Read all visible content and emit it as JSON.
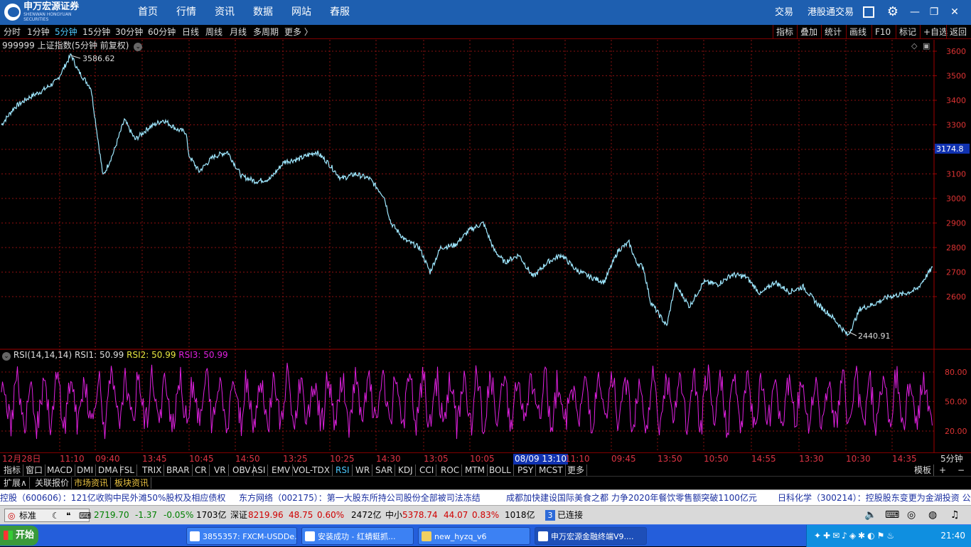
{
  "app": {
    "logo_text": "申万宏源证券",
    "logo_sub": "SHENWAN HONGYUAN SECURITIES"
  },
  "nav": [
    "首页",
    "行情",
    "资讯",
    "数据",
    "网站",
    "舂服"
  ],
  "top_right": {
    "trade": "交易",
    "hk_trade": "港股通交易"
  },
  "periods": [
    "分时",
    "1分钟",
    "5分钟",
    "15分钟",
    "30分钟",
    "60分钟",
    "日线",
    "周线",
    "月线",
    "多周期",
    "更多 〉"
  ],
  "active_period": "5分钟",
  "right_tools": [
    "指标",
    "叠加",
    "统计",
    "画线",
    "F10",
    "标记",
    "+自选",
    "返回"
  ],
  "chart_title": "999999 上证指数(5分钟 前复权)",
  "rsi_title": {
    "name": "RSI(14,14,14)",
    "rsi1": "RSI1: 50.99",
    "rsi2": "RSI2: 50.99",
    "rsi3": "RSI3: 50.99"
  },
  "price_axis": [
    "3600",
    "3500",
    "3400",
    "3300",
    "3200",
    "3100",
    "3000",
    "2900",
    "2800",
    "2700",
    "2600"
  ],
  "current_price": "3174.8",
  "high_label": "3586.62",
  "low_label": "2440.91",
  "rsi_axis": [
    "80.00",
    "50.00",
    "20.00"
  ],
  "time_axis": [
    "12月28日",
    "11:10",
    "09:40",
    "13:45",
    "10:45",
    "14:50",
    "13:25",
    "10:25",
    "14:30",
    "13:05",
    "10:05",
    "08/09 13:10",
    "11:10",
    "09:45",
    "13:50",
    "10:50",
    "14:55",
    "13:30",
    "10:30",
    "14:35"
  ],
  "time_axis_right": "5分钟",
  "indicators": [
    "指标",
    "窗口",
    "MACD",
    "DMI",
    "DMA",
    "FSL",
    "TRIX",
    "BRAR",
    "CR",
    "VR",
    "OBV",
    "ASI",
    "EMV",
    "VOL-TDX",
    "RSI",
    "WR",
    "SAR",
    "KDJ",
    "CCI",
    "ROC",
    "MTM",
    "BOLL",
    "PSY",
    "MCST",
    "更多"
  ],
  "active_indicator": "RSI",
  "indicator_right": [
    "模板",
    "+",
    "−"
  ],
  "tabs": [
    "扩展∧",
    "关联报价",
    "市场资讯",
    "板块资讯"
  ],
  "ticker": [
    "控股（600606）：121亿收购中民外滩50%股权及相应债权",
    "东方网络（002175）：第一大股东所持公司股份全部被司法冻结",
    "成都加快建设国际美食之都  力争2020年餐饮零售额突破1100亿元",
    "日科化学（300214）：控股股东变更为金湖投资  公"
  ],
  "status": {
    "mode": "标准",
    "sh_value": "2719.70",
    "sh_change": "-1.37",
    "sh_pct": "-0.05%",
    "sh_amount": "1703亿",
    "sz_label": "深证",
    "sz_value": "8219.96",
    "sz_change": "48.75",
    "sz_pct": "0.60%",
    "sz_amount": "2472亿",
    "zx_label": "中小",
    "zx_value": "5378.74",
    "zx_change": "44.07",
    "zx_pct": "0.83%",
    "zx_amount": "1018亿",
    "conn_num": "3",
    "conn_text": "已连接"
  },
  "taskbar": {
    "start": "开始",
    "tasks": [
      "3855357: FXCM-USDDe...",
      "安装成功 - 红蜻蜓抓...",
      "new_hyzq_v6",
      "申万宏源金融终端V9...."
    ],
    "clock": "21:40"
  },
  "colors": {
    "line": "#9fe8ff",
    "rsi": "#e020e0",
    "grid": "#800000",
    "down": "#ff3030"
  }
}
